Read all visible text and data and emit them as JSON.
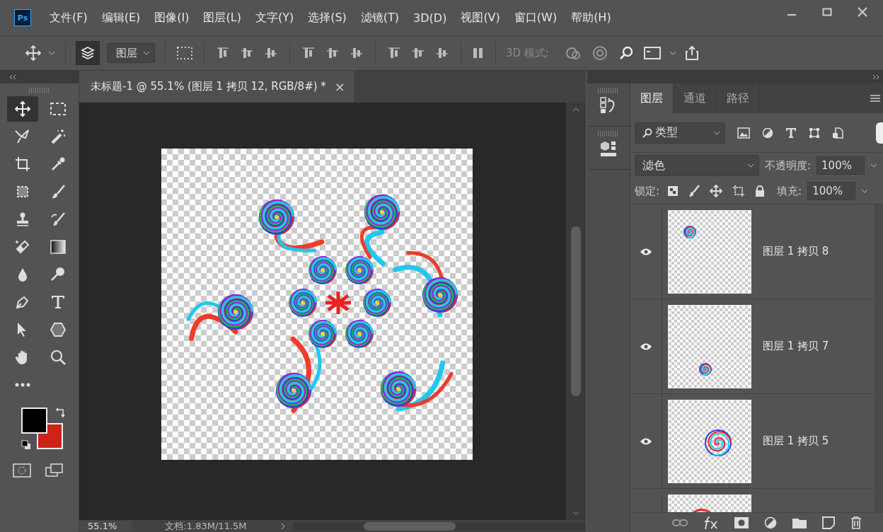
{
  "menu": {
    "app_icon": "Ps",
    "items": [
      "文件(F)",
      "编辑(E)",
      "图像(I)",
      "图层(L)",
      "文字(Y)",
      "选择(S)",
      "滤镜(T)",
      "3D(D)",
      "视图(V)",
      "窗口(W)",
      "帮助(H)"
    ]
  },
  "options_bar": {
    "layer_select": "图层",
    "mode_label": "3D 模式:"
  },
  "document": {
    "tab_title": "未标题-1 @ 55.1% (图层 1 拷贝 12, RGB/8#) *",
    "close": "×"
  },
  "tools": [
    {
      "kind": "move",
      "selected": true
    },
    {
      "kind": "marquee",
      "selected": false
    },
    {
      "kind": "lasso",
      "selected": false
    },
    {
      "kind": "wand",
      "selected": false
    },
    {
      "kind": "crop",
      "selected": false
    },
    {
      "kind": "eyedropper",
      "selected": false
    },
    {
      "kind": "patch",
      "selected": false
    },
    {
      "kind": "brush",
      "selected": false
    },
    {
      "kind": "stamp",
      "selected": false
    },
    {
      "kind": "history",
      "selected": false
    },
    {
      "kind": "eraser",
      "selected": false
    },
    {
      "kind": "gradient",
      "selected": false
    },
    {
      "kind": "drop",
      "selected": false
    },
    {
      "kind": "dodge",
      "selected": false
    },
    {
      "kind": "pen",
      "selected": false
    },
    {
      "kind": "type",
      "selected": false
    },
    {
      "kind": "arrow",
      "selected": false
    },
    {
      "kind": "hexagon",
      "selected": false
    },
    {
      "kind": "hand",
      "selected": false
    },
    {
      "kind": "zoom",
      "selected": false
    },
    {
      "kind": "more",
      "selected": false
    }
  ],
  "status_bar": {
    "zoom": "55.1%",
    "doc_size": "文档:1.83M/11.5M"
  },
  "layers_panel": {
    "tabs": [
      {
        "label": "图层",
        "selected": true
      },
      {
        "label": "通道",
        "selected": false
      },
      {
        "label": "路径",
        "selected": false
      }
    ],
    "filter": "类型",
    "blend_mode": "滤色",
    "opacity_label": "不透明度:",
    "opacity": "100%",
    "lock_label": "锁定:",
    "fill_label": "填充:",
    "fill": "100%",
    "layers": [
      {
        "name": "图层 1 拷贝 8",
        "visible": true,
        "selected": false
      },
      {
        "name": "图层 1 拷贝 7",
        "visible": true,
        "selected": false
      },
      {
        "name": "图层 1 拷贝 5",
        "visible": true,
        "selected": false
      }
    ]
  }
}
